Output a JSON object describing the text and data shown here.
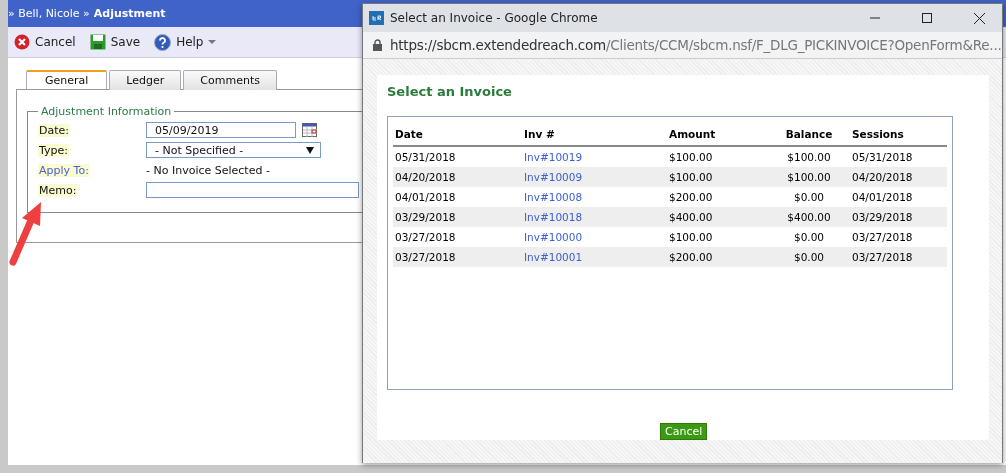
{
  "app": {
    "breadcrumb": {
      "path": "» Bell, Nicole »",
      "current": "Adjustment"
    },
    "toolbar": [
      {
        "label": "Cancel",
        "kind": "cancel"
      },
      {
        "label": "Save",
        "kind": "save"
      },
      {
        "label": "Help",
        "kind": "help"
      }
    ],
    "tabs": [
      {
        "label": "General",
        "selected": true
      },
      {
        "label": "Ledger",
        "selected": false
      },
      {
        "label": "Comments",
        "selected": false
      }
    ],
    "legend": "Adjustment Information",
    "fields": [
      {
        "label": "Date:",
        "kind": "date",
        "value": "05/09/2019"
      },
      {
        "label": "Type:",
        "kind": "select",
        "value": "- Not Specified -"
      },
      {
        "label": "Apply To:",
        "kind": "link",
        "value": "- No Invoice Selected -"
      },
      {
        "label": "Memo:",
        "kind": "text"
      }
    ]
  },
  "popup": {
    "title": "Select an Invoice - Google Chrome",
    "url_host": "https://sbcm.extendedreach.com",
    "url_path": "/Clients/CCM/sbcm.nsf/F_DLG_PICKINVOICE?OpenForm&Re...",
    "heading": "Select an Invoice",
    "table": {
      "columns": [
        "Date",
        "Inv #",
        "Amount",
        "Balance",
        "Sessions"
      ],
      "rows": [
        [
          "05/31/2018",
          "Inv#10019",
          "$100.00",
          "$100.00",
          "05/31/2018"
        ],
        [
          "04/20/2018",
          "Inv#10009",
          "$100.00",
          "$100.00",
          "04/20/2018"
        ],
        [
          "04/01/2018",
          "Inv#10008",
          "$200.00",
          "$0.00",
          "04/01/2018"
        ],
        [
          "03/29/2018",
          "Inv#10018",
          "$400.00",
          "$400.00",
          "03/29/2018"
        ],
        [
          "03/27/2018",
          "Inv#10000",
          "$100.00",
          "$0.00",
          "03/27/2018"
        ],
        [
          "03/27/2018",
          "Inv#10001",
          "$200.00",
          "$0.00",
          "03/27/2018"
        ]
      ]
    },
    "button": "Cancel"
  }
}
